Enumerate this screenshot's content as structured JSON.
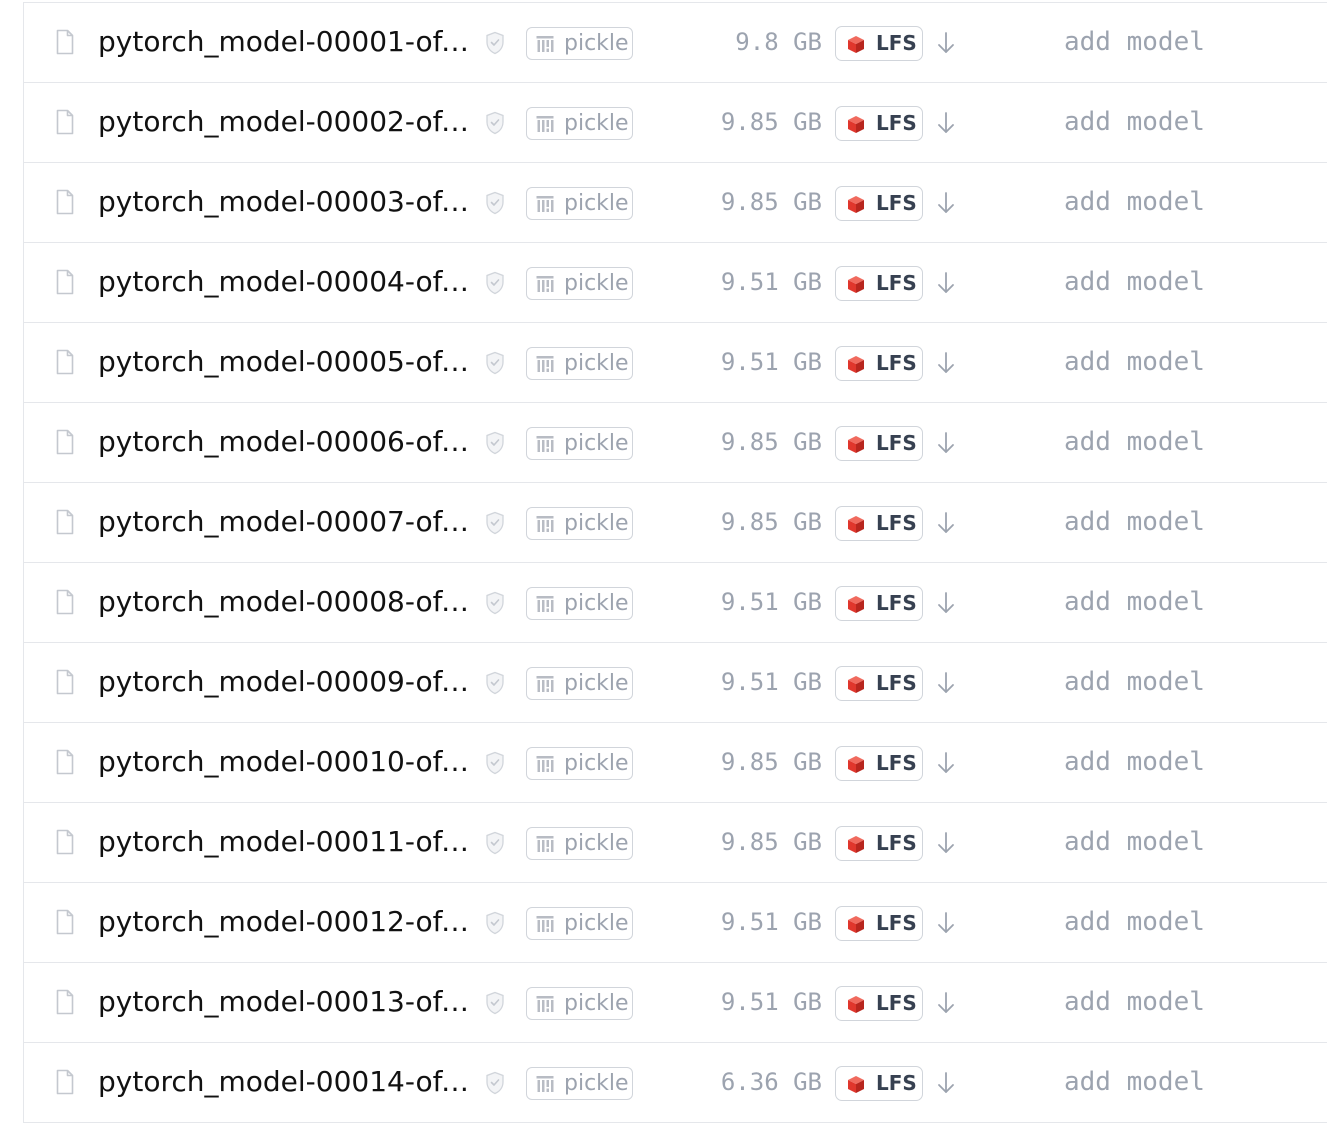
{
  "files": [
    {
      "name": "pytorch_model-00001-of-…",
      "security_icon": "shield-check-icon",
      "badge": {
        "icon": "pickle-icon",
        "label": "pickle"
      },
      "size": "9.8 GB",
      "lfs": {
        "icon": "lfs-cube-icon",
        "label": "LFS"
      },
      "download_icon": "download-arrow-icon",
      "commit": "add model"
    },
    {
      "name": "pytorch_model-00002-of-…",
      "security_icon": "shield-check-icon",
      "badge": {
        "icon": "pickle-icon",
        "label": "pickle"
      },
      "size": "9.85 GB",
      "lfs": {
        "icon": "lfs-cube-icon",
        "label": "LFS"
      },
      "download_icon": "download-arrow-icon",
      "commit": "add model"
    },
    {
      "name": "pytorch_model-00003-of-…",
      "security_icon": "shield-check-icon",
      "badge": {
        "icon": "pickle-icon",
        "label": "pickle"
      },
      "size": "9.85 GB",
      "lfs": {
        "icon": "lfs-cube-icon",
        "label": "LFS"
      },
      "download_icon": "download-arrow-icon",
      "commit": "add model"
    },
    {
      "name": "pytorch_model-00004-of-…",
      "security_icon": "shield-check-icon",
      "badge": {
        "icon": "pickle-icon",
        "label": "pickle"
      },
      "size": "9.51 GB",
      "lfs": {
        "icon": "lfs-cube-icon",
        "label": "LFS"
      },
      "download_icon": "download-arrow-icon",
      "commit": "add model"
    },
    {
      "name": "pytorch_model-00005-of-…",
      "security_icon": "shield-check-icon",
      "badge": {
        "icon": "pickle-icon",
        "label": "pickle"
      },
      "size": "9.51 GB",
      "lfs": {
        "icon": "lfs-cube-icon",
        "label": "LFS"
      },
      "download_icon": "download-arrow-icon",
      "commit": "add model"
    },
    {
      "name": "pytorch_model-00006-of-…",
      "security_icon": "shield-check-icon",
      "badge": {
        "icon": "pickle-icon",
        "label": "pickle"
      },
      "size": "9.85 GB",
      "lfs": {
        "icon": "lfs-cube-icon",
        "label": "LFS"
      },
      "download_icon": "download-arrow-icon",
      "commit": "add model"
    },
    {
      "name": "pytorch_model-00007-of-…",
      "security_icon": "shield-check-icon",
      "badge": {
        "icon": "pickle-icon",
        "label": "pickle"
      },
      "size": "9.85 GB",
      "lfs": {
        "icon": "lfs-cube-icon",
        "label": "LFS"
      },
      "download_icon": "download-arrow-icon",
      "commit": "add model"
    },
    {
      "name": "pytorch_model-00008-of-…",
      "security_icon": "shield-check-icon",
      "badge": {
        "icon": "pickle-icon",
        "label": "pickle"
      },
      "size": "9.51 GB",
      "lfs": {
        "icon": "lfs-cube-icon",
        "label": "LFS"
      },
      "download_icon": "download-arrow-icon",
      "commit": "add model"
    },
    {
      "name": "pytorch_model-00009-of-…",
      "security_icon": "shield-check-icon",
      "badge": {
        "icon": "pickle-icon",
        "label": "pickle"
      },
      "size": "9.51 GB",
      "lfs": {
        "icon": "lfs-cube-icon",
        "label": "LFS"
      },
      "download_icon": "download-arrow-icon",
      "commit": "add model"
    },
    {
      "name": "pytorch_model-00010-of-…",
      "security_icon": "shield-check-icon",
      "badge": {
        "icon": "pickle-icon",
        "label": "pickle"
      },
      "size": "9.85 GB",
      "lfs": {
        "icon": "lfs-cube-icon",
        "label": "LFS"
      },
      "download_icon": "download-arrow-icon",
      "commit": "add model"
    },
    {
      "name": "pytorch_model-00011-of-…",
      "security_icon": "shield-check-icon",
      "badge": {
        "icon": "pickle-icon",
        "label": "pickle"
      },
      "size": "9.85 GB",
      "lfs": {
        "icon": "lfs-cube-icon",
        "label": "LFS"
      },
      "download_icon": "download-arrow-icon",
      "commit": "add model"
    },
    {
      "name": "pytorch_model-00012-of-…",
      "security_icon": "shield-check-icon",
      "badge": {
        "icon": "pickle-icon",
        "label": "pickle"
      },
      "size": "9.51 GB",
      "lfs": {
        "icon": "lfs-cube-icon",
        "label": "LFS"
      },
      "download_icon": "download-arrow-icon",
      "commit": "add model"
    },
    {
      "name": "pytorch_model-00013-of-…",
      "security_icon": "shield-check-icon",
      "badge": {
        "icon": "pickle-icon",
        "label": "pickle"
      },
      "size": "9.51 GB",
      "lfs": {
        "icon": "lfs-cube-icon",
        "label": "LFS"
      },
      "download_icon": "download-arrow-icon",
      "commit": "add model"
    },
    {
      "name": "pytorch_model-00014-of-…",
      "security_icon": "shield-check-icon",
      "badge": {
        "icon": "pickle-icon",
        "label": "pickle"
      },
      "size": "6.36 GB",
      "lfs": {
        "icon": "lfs-cube-icon",
        "label": "LFS"
      },
      "download_icon": "download-arrow-icon",
      "commit": "add model"
    }
  ],
  "colors": {
    "file_name": "#111111",
    "muted_text": "#9ca3af",
    "border": "#e5e7eb",
    "badge_border": "#d1d5db",
    "lfs_red": "#e0362c",
    "lfs_label": "#374151"
  }
}
